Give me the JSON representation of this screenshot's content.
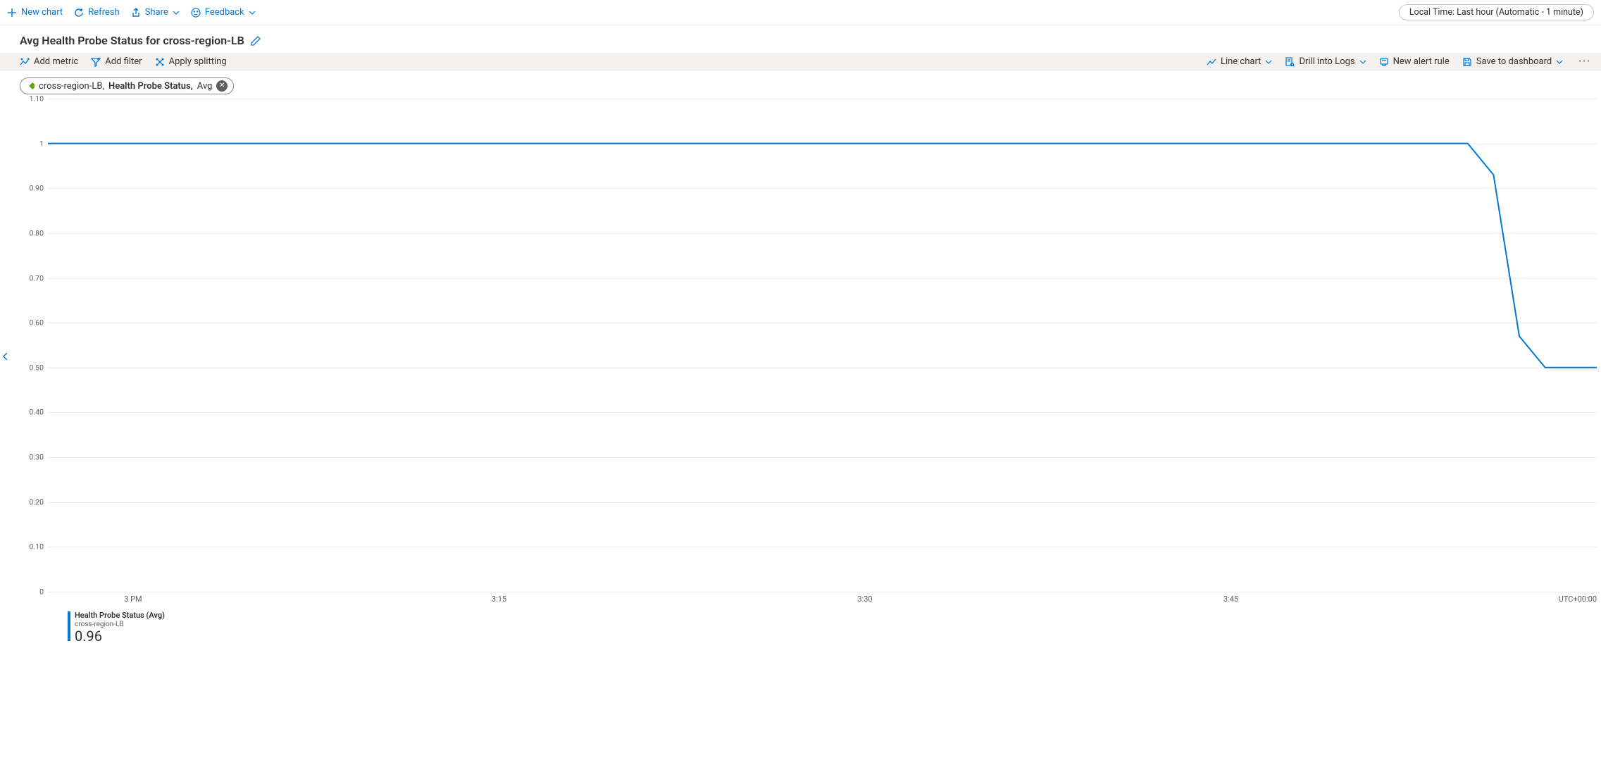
{
  "top_commands": {
    "new_chart": "New chart",
    "refresh": "Refresh",
    "share": "Share",
    "feedback": "Feedback"
  },
  "time_range": "Local Time: Last hour (Automatic - 1 minute)",
  "page_title": "Avg Health Probe Status for cross-region-LB",
  "chart_toolbar": {
    "add_metric": "Add metric",
    "add_filter": "Add filter",
    "apply_splitting": "Apply splitting",
    "line_chart": "Line chart",
    "drill_into_logs": "Drill into Logs",
    "new_alert_rule": "New alert rule",
    "save_to_dashboard": "Save to dashboard"
  },
  "metric_pill": {
    "resource": "cross-region-LB,",
    "metric": "Health Probe Status,",
    "agg": "Avg"
  },
  "legend": {
    "name": "Health Probe Status (Avg)",
    "sub": "cross-region-LB",
    "value": "0.96"
  },
  "timezone": "UTC+00:00",
  "colors": {
    "series": "#0078d4"
  },
  "chart_data": {
    "type": "line",
    "title": "Avg Health Probe Status for cross-region-LB",
    "xlabel": "",
    "ylabel": "",
    "ylim": [
      0,
      1.1
    ],
    "y_ticks": [
      1.1,
      1,
      0.9,
      0.8,
      0.7,
      0.6,
      0.5,
      0.4,
      0.3,
      0.2,
      0.1,
      0
    ],
    "x_ticks": [
      "3 PM",
      "3:15",
      "3:30",
      "3:45"
    ],
    "series": [
      {
        "name": "Health Probe Status (Avg)",
        "resource": "cross-region-LB",
        "color": "#0078d4",
        "x_minutes": [
          0,
          1,
          2,
          3,
          4,
          5,
          6,
          7,
          8,
          9,
          10,
          11,
          12,
          13,
          14,
          15,
          16,
          17,
          18,
          19,
          20,
          21,
          22,
          23,
          24,
          25,
          26,
          27,
          28,
          29,
          30,
          31,
          32,
          33,
          34,
          35,
          36,
          37,
          38,
          39,
          40,
          41,
          42,
          43,
          44,
          45,
          46,
          47,
          48,
          49,
          50,
          51,
          52,
          53,
          54,
          55,
          56,
          57,
          58,
          59,
          60
        ],
        "values": [
          1,
          1,
          1,
          1,
          1,
          1,
          1,
          1,
          1,
          1,
          1,
          1,
          1,
          1,
          1,
          1,
          1,
          1,
          1,
          1,
          1,
          1,
          1,
          1,
          1,
          1,
          1,
          1,
          1,
          1,
          1,
          1,
          1,
          1,
          1,
          1,
          1,
          1,
          1,
          1,
          1,
          1,
          1,
          1,
          1,
          1,
          1,
          1,
          1,
          1,
          1,
          1,
          1,
          1,
          1,
          1,
          0.93,
          0.57,
          0.5,
          0.5,
          0.5
        ]
      }
    ]
  }
}
